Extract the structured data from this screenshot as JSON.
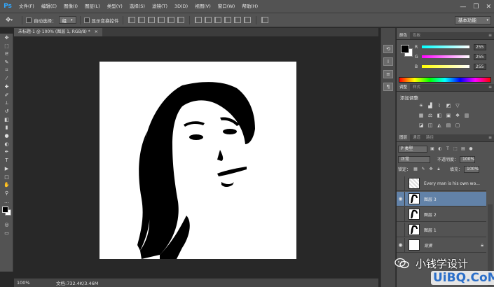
{
  "app": {
    "logo": "Ps"
  },
  "menu": {
    "items": [
      "文件(F)",
      "编辑(E)",
      "图像(I)",
      "图层(L)",
      "类型(Y)",
      "选择(S)",
      "滤镜(T)",
      "3D(D)",
      "视图(V)",
      "窗口(W)",
      "帮助(H)"
    ]
  },
  "window_controls": {
    "minimize": "—",
    "restore": "❐",
    "close": "✕"
  },
  "options": {
    "auto_select_label": "自动选择：",
    "auto_select_target": "组",
    "show_transform_label": "显示变换控件",
    "workspace": "基本功能"
  },
  "document": {
    "tab_title": "未标题-1 @ 100% (图层 1, RGB/8) *",
    "close_icon": "×"
  },
  "status": {
    "zoom": "100%",
    "doc_size": "文档:732.4K/3.46M"
  },
  "color_panel": {
    "tabs": [
      "颜色",
      "色板"
    ],
    "channels": [
      {
        "label": "R",
        "value": "255"
      },
      {
        "label": "G",
        "value": "255"
      },
      {
        "label": "B",
        "value": "255"
      }
    ],
    "foreground": "#000000",
    "background": "#ffffff"
  },
  "adjust_panel": {
    "tabs": [
      "调整",
      "样式"
    ],
    "title": "添加调整"
  },
  "layers_panel": {
    "tabs": [
      "图层",
      "通道",
      "路径"
    ],
    "filter": "P 类型",
    "blend_mode": "正常",
    "opacity_label": "不透明度：",
    "opacity": "100%",
    "lock_label": "锁定：",
    "fill_label": "填充：",
    "fill": "100%",
    "layers": [
      {
        "name": "Every man is his own wo...",
        "visible": false,
        "selected": false
      },
      {
        "name": "图层 3",
        "visible": true,
        "selected": true
      },
      {
        "name": "图层 2",
        "visible": false,
        "selected": false
      },
      {
        "name": "图层 1",
        "visible": false,
        "selected": false
      },
      {
        "name": "背景",
        "visible": true,
        "selected": false
      }
    ]
  },
  "watermark": {
    "line1": "小钱学设计",
    "line2": "UiBQ.CoM"
  },
  "colors": {
    "selected_layer": "#6282a8",
    "ps_blue": "#31a8ff"
  }
}
